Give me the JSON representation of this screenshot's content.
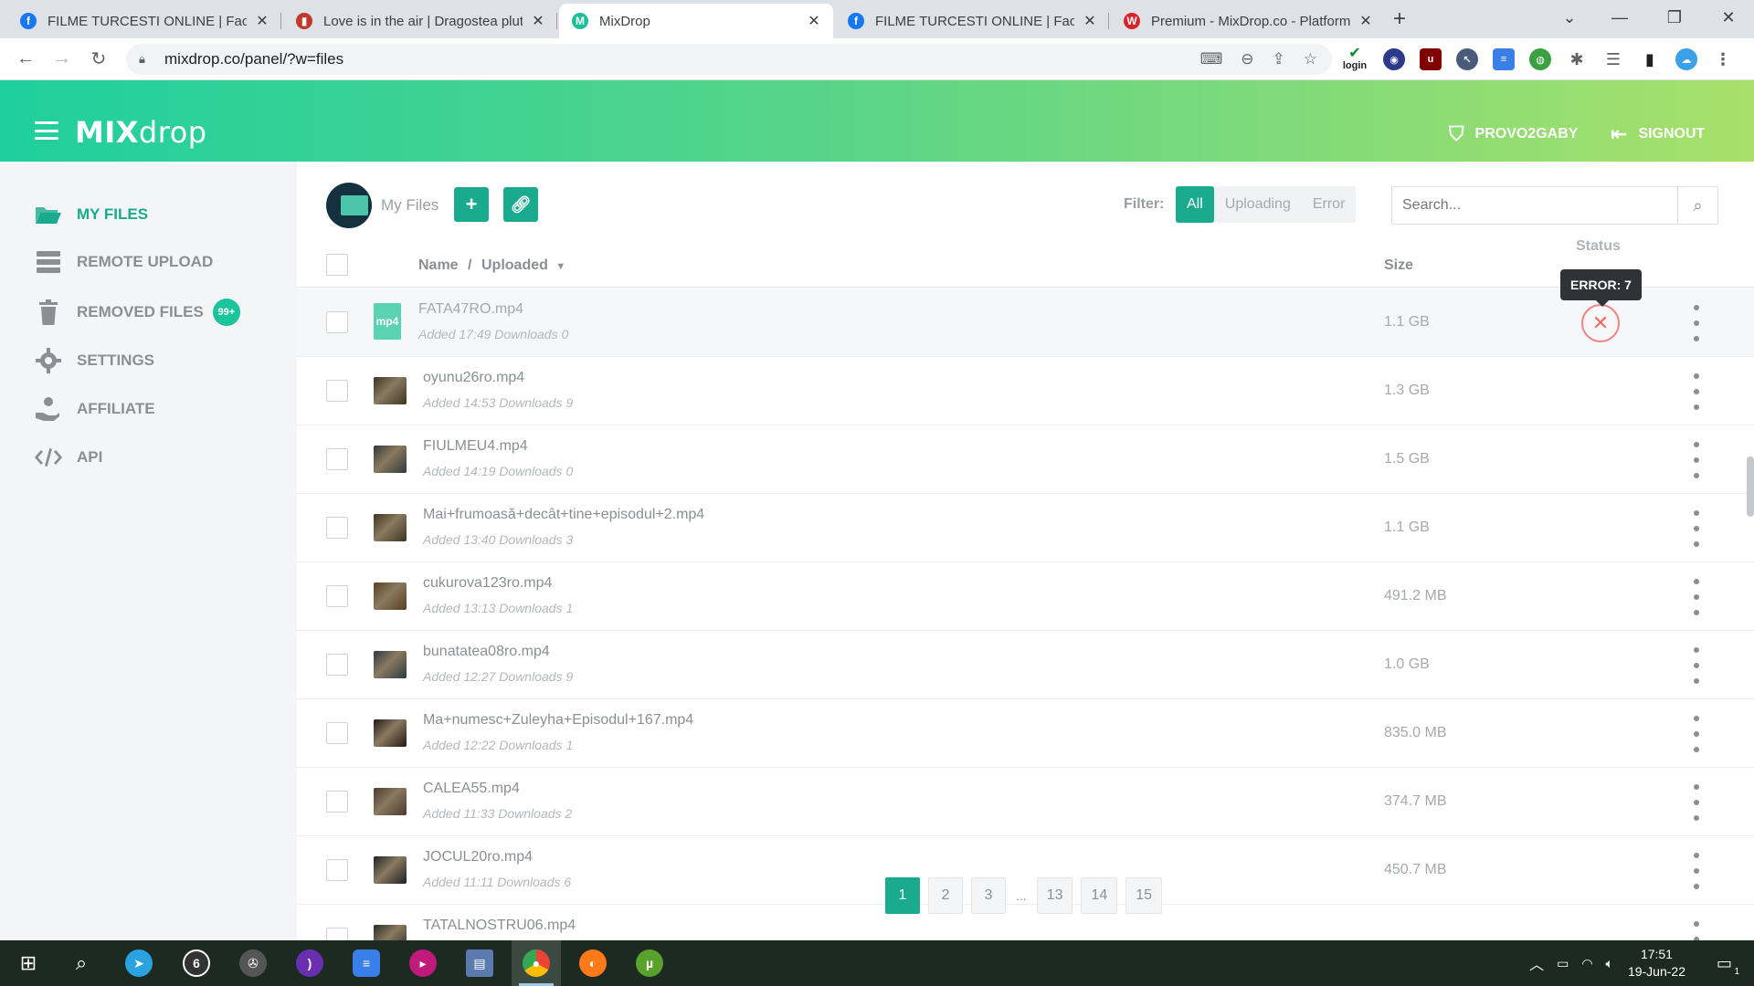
{
  "browser": {
    "tabs": [
      {
        "title": "FILME TURCESTI ONLINE | Facebook",
        "favicon": "facebook-icon",
        "color": "#1877f2",
        "glyph": "f",
        "active": false
      },
      {
        "title": "Love is in the air | Dragostea plutește",
        "favicon": "striped-bag-icon",
        "color": "#c0392b",
        "glyph": "▮",
        "active": false
      },
      {
        "title": "MixDrop",
        "favicon": "mixdrop-icon",
        "color": "#1cbf98",
        "glyph": "M",
        "active": true
      },
      {
        "title": "FILME TURCESTI ONLINE | Facebook",
        "favicon": "facebook-icon",
        "color": "#1877f2",
        "glyph": "f",
        "active": false
      },
      {
        "title": "Premium - MixDrop.co - Platform",
        "favicon": "w-icon",
        "color": "#d8232a",
        "glyph": "W",
        "active": false
      }
    ],
    "url": "mixdrop.co/panel/?w=files",
    "extension_label": "login"
  },
  "app": {
    "logo_bold": "MIX",
    "logo_light": "drop",
    "username": "PROVO2GABY",
    "signout": "SIGNOUT",
    "accent": "#1aab8f"
  },
  "sidebar": {
    "items": [
      {
        "label": "MY FILES",
        "icon": "folder-open-icon",
        "active": true
      },
      {
        "label": "REMOTE UPLOAD",
        "icon": "server-icon",
        "active": false
      },
      {
        "label": "REMOVED FILES",
        "icon": "trash-icon",
        "active": false,
        "badge": "99+"
      },
      {
        "label": "SETTINGS",
        "icon": "gear-icon",
        "active": false
      },
      {
        "label": "AFFILIATE",
        "icon": "hand-coin-icon",
        "active": false
      },
      {
        "label": "API",
        "icon": "code-icon",
        "active": false
      }
    ]
  },
  "files_panel": {
    "title": "My Files",
    "filter_label": "Filter:",
    "filters": [
      "All",
      "Uploading",
      "Error"
    ],
    "active_filter": "All",
    "search_placeholder": "Search...",
    "columns": {
      "name": "Name",
      "separator": "/",
      "uploaded": "Uploaded",
      "size": "Size",
      "status": "Status"
    },
    "tooltip": "ERROR: 7",
    "rows": [
      {
        "name": "FATA47RO.mp4",
        "meta": "Added 17:49 Downloads 0",
        "size": "1.1 GB",
        "error": true,
        "file_type": "mp4"
      },
      {
        "name": "oyunu26ro.mp4",
        "meta": "Added 14:53 Downloads 9",
        "size": "1.3 GB",
        "error": false,
        "thumb": "#3a3520"
      },
      {
        "name": "FIULMEU4.mp4",
        "meta": "Added 14:19 Downloads 0",
        "size": "1.5 GB",
        "error": false,
        "thumb": "#2f3a3a"
      },
      {
        "name": "Mai+frumoasă+decât+tine+episodul+2.mp4",
        "meta": "Added 13:40 Downloads 3",
        "size": "1.1 GB",
        "error": false,
        "thumb": "#3d3520"
      },
      {
        "name": "cukurova123ro.mp4",
        "meta": "Added 13:13 Downloads 1",
        "size": "491.2 MB",
        "error": false,
        "thumb": "#5a4020"
      },
      {
        "name": "bunatatea08ro.mp4",
        "meta": "Added 12:27 Downloads 9",
        "size": "1.0 GB",
        "error": false,
        "thumb": "#2e3a40"
      },
      {
        "name": "Ma+numesc+Zuleyha+Episodul+167.mp4",
        "meta": "Added 12:22 Downloads 1",
        "size": "835.0 MB",
        "error": false,
        "thumb": "#241a14"
      },
      {
        "name": "CALEA55.mp4",
        "meta": "Added 11:33 Downloads 2",
        "size": "374.7 MB",
        "error": false,
        "thumb": "#4a3a2c"
      },
      {
        "name": "JOCUL20ro.mp4",
        "meta": "Added 11:11 Downloads 6",
        "size": "450.7 MB",
        "error": false,
        "thumb": "#1f2024"
      },
      {
        "name": "TATALNOSTRU06.mp4",
        "meta": "",
        "size": "",
        "error": false,
        "thumb": "#2a2c28"
      }
    ],
    "pagination": [
      "1",
      "2",
      "3",
      "...",
      "13",
      "14",
      "15"
    ],
    "current_page": "1"
  },
  "taskbar": {
    "time": "17:51",
    "date": "19-Jun-22",
    "notifications": "1"
  }
}
